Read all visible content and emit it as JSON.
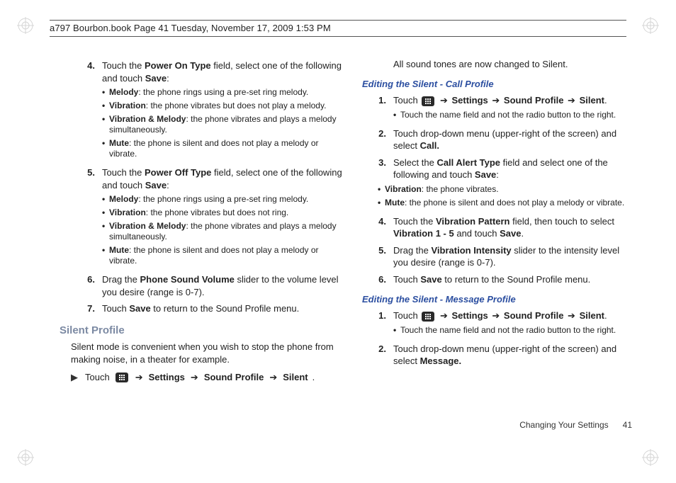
{
  "header_meta": "a797 Bourbon.book  Page 41  Tuesday, November 17, 2009  1:53 PM",
  "left": {
    "step4": {
      "num": "4.",
      "text_pre": "Touch the ",
      "bold1": "Power On Type",
      "text_mid": " field, select one of the following and touch ",
      "bold2": "Save",
      "text_post": ":",
      "bullets": [
        {
          "label": "Melody",
          "rest": ": the phone rings using a pre-set ring melody."
        },
        {
          "label": "Vibration",
          "rest": ": the phone vibrates but does not play a melody."
        },
        {
          "label": "Vibration & Melody",
          "rest": ": the phone vibrates and plays a melody simultaneously."
        },
        {
          "label": "Mute",
          "rest": ": the phone is silent and does not play a melody or vibrate."
        }
      ]
    },
    "step5": {
      "num": "5.",
      "text_pre": "Touch the ",
      "bold1": "Power Off Type",
      "text_mid": " field, select one of the following and touch ",
      "bold2": "Save",
      "text_post": ":",
      "bullets": [
        {
          "label": "Melody",
          "rest": ": the phone rings using a pre-set ring melody."
        },
        {
          "label": "Vibration",
          "rest": ": the phone vibrates but does not ring."
        },
        {
          "label": "Vibration & Melody",
          "rest": ": the phone vibrates and plays a melody simultaneously."
        },
        {
          "label": "Mute",
          "rest": ": the phone is silent and does not play a melody or vibrate."
        }
      ]
    },
    "step6": {
      "num": "6.",
      "text_pre": "Drag the ",
      "bold1": "Phone Sound Volume",
      "text_post": " slider to the volume level you desire (range is 0-7)."
    },
    "step7": {
      "num": "7.",
      "text_pre": "Touch ",
      "bold1": "Save",
      "text_post": " to return to the Sound Profile menu."
    },
    "silent_heading": "Silent Profile",
    "silent_desc": "Silent mode is convenient when you wish to stop the phone from making noise, in a theater for example.",
    "silent_arrow": {
      "pre": "Touch ",
      "arrow": "➔",
      "b1": "Settings",
      "b2": "Sound Profile",
      "b3": "Silent",
      "dot": "."
    }
  },
  "right": {
    "intro": "All sound tones are now changed to Silent.",
    "subA": "Editing the Silent - Call Profile",
    "a1": {
      "num": "1.",
      "pre": "Touch ",
      "arrow": "➔",
      "b1": "Settings",
      "b2": "Sound Profile",
      "b3": "Silent",
      "dot": ".",
      "note": "Touch the name field and not the radio button to the right."
    },
    "a2": {
      "num": "2.",
      "text": "Touch drop-down menu (upper-right of the screen) and select ",
      "bold": "Call."
    },
    "a3": {
      "num": "3.",
      "pre": "Select the ",
      "bold1": "Call Alert Type",
      "mid": " field and select one of the following and touch ",
      "bold2": "Save",
      "post": ":",
      "bullets": [
        {
          "label": "Vibration",
          "rest": ": the phone vibrates."
        },
        {
          "label": "Mute",
          "rest": ": the phone is silent and does not play a melody or vibrate."
        }
      ]
    },
    "a4": {
      "num": "4.",
      "pre": "Touch the ",
      "bold1": "Vibration Pattern",
      "mid": " field, then touch to select ",
      "bold2": "Vibration 1 - 5",
      "mid2": " and touch ",
      "bold3": "Save",
      "post": "."
    },
    "a5": {
      "num": "5.",
      "pre": "Drag the ",
      "bold1": "Vibration Intensity",
      "post": " slider to the intensity level you desire (range is 0-7)."
    },
    "a6": {
      "num": "6.",
      "pre": "Touch ",
      "bold1": "Save",
      "post": " to return to the Sound Profile menu."
    },
    "subB": "Editing the Silent - Message Profile",
    "b1": {
      "num": "1.",
      "pre": "Touch ",
      "arrow": "➔",
      "s1": "Settings",
      "s2": "Sound Profile",
      "s3": "Silent",
      "dot": ".",
      "note": "Touch the name field and not the radio button to the right."
    },
    "b2": {
      "num": "2.",
      "text": "Touch drop-down menu (upper-right of the screen) and select ",
      "bold": "Message."
    }
  },
  "footer": {
    "label": "Changing Your Settings",
    "page": "41"
  },
  "menu_icon_name": "menu-icon"
}
